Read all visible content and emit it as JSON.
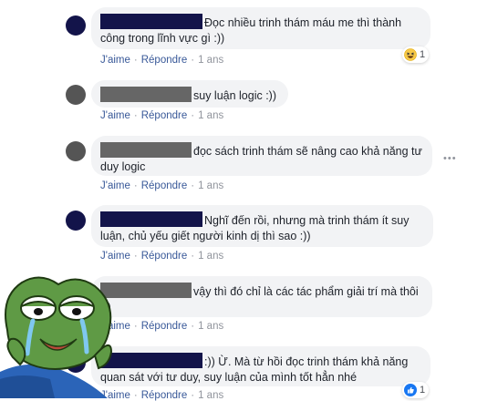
{
  "comments": [
    {
      "id": 1,
      "text": "Đọc nhiều trinh thám máu me thì thành công trong lĩnh vực gì :))",
      "avatar_color": "#13144a",
      "reaction": {
        "type": "haha-icon",
        "count": "1"
      }
    },
    {
      "id": 2,
      "text": "suy luận logic :))",
      "avatar_color": "#555555"
    },
    {
      "id": 3,
      "text": "đọc sách trinh thám sẽ nâng cao khả năng tư duy logic",
      "avatar_color": "#555555",
      "more_options": "•••"
    },
    {
      "id": 4,
      "text": "Nghĩ đến rồi, nhưng mà trinh thám ít suy luận, chủ yếu giết người kinh dị thì sao :))",
      "avatar_color": "#13144a"
    },
    {
      "id": 5,
      "text": "vậy thì đó chỉ là các tác phẩm giải trí mà thôi :))",
      "avatar_color": "#555555"
    },
    {
      "id": 6,
      "text": ":)) Ừ. Mà từ hồi đọc trinh thám khả năng quan sát với tư duy, suy luận của mình tốt hẳn nhé",
      "avatar_color": "#13144a",
      "reaction": {
        "type": "like-icon",
        "count": "1"
      }
    }
  ],
  "actions": {
    "like": "J'aime",
    "reply": "Répondre",
    "separator": "·",
    "time": "1 ans"
  },
  "colors": {
    "link": "#385898",
    "bubble": "#f2f3f5",
    "redaction_navy": "#13144a",
    "redaction_grey": "#666666"
  }
}
